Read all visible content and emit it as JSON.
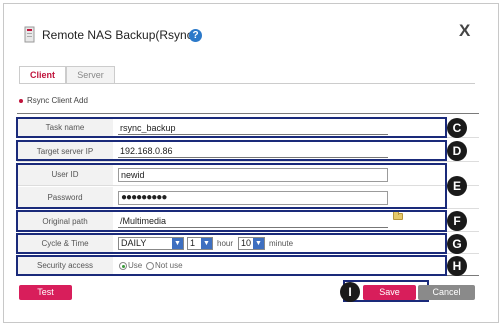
{
  "dialog": {
    "title": "Remote NAS Backup(Rsync)",
    "help_icon": "question-circle-icon",
    "close_label": "X"
  },
  "tabs": [
    {
      "label": "Client",
      "active": true
    },
    {
      "label": "Server",
      "active": false
    }
  ],
  "section_title": "Rsync Client Add",
  "form": {
    "task_name": {
      "label": "Task name",
      "value": "rsync_backup"
    },
    "target_server_ip": {
      "label": "Target server IP",
      "value": "192.168.0.86"
    },
    "user_id": {
      "label": "User ID",
      "value": "newid"
    },
    "password": {
      "label": "Password",
      "value": "●●●●●●●●●"
    },
    "original_path": {
      "label": "Original path",
      "value": "/Multimedia",
      "folder_icon": "folder-icon"
    },
    "cycle_time": {
      "label": "Cycle & Time",
      "cycle": "DAILY",
      "hour": "1",
      "hour_unit": "hour",
      "minute": "10",
      "minute_unit": "minute"
    },
    "security_access": {
      "label": "Security access",
      "options": [
        "Use",
        "Not use"
      ],
      "selected": "Use"
    }
  },
  "buttons": {
    "test": "Test",
    "save": "Save",
    "cancel": "Cancel"
  },
  "annotations": {
    "c": "C",
    "d": "D",
    "e": "E",
    "f": "F",
    "g": "G",
    "h": "H",
    "i": "I"
  },
  "colors": {
    "accent": "#d81e5b",
    "highlight_border": "#1a2a7a",
    "badge": "#1a1a1a",
    "select_arrow": "#3e6fc0"
  }
}
